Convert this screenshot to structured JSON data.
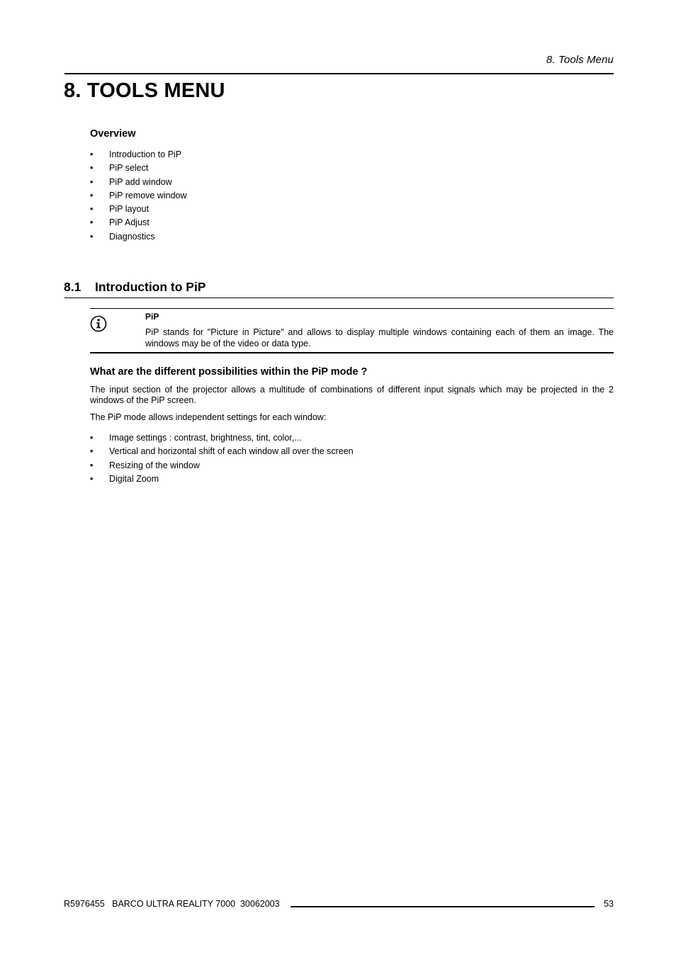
{
  "header": {
    "running_title": "8.  Tools Menu"
  },
  "chapter": {
    "title": "8. TOOLS MENU"
  },
  "overview": {
    "heading": "Overview",
    "items": [
      "Introduction to PiP",
      "PiP select",
      "PiP add window",
      "PiP remove window",
      "PiP layout",
      "PiP Adjust",
      "Diagnostics"
    ]
  },
  "section": {
    "number": "8.1",
    "title": "Introduction to PiP"
  },
  "note": {
    "icon": "info-icon",
    "title": "PiP",
    "body": "PiP stands for \"Picture in Picture\" and allows to display multiple windows containing each of them an image.  The windows may be of the video or data type."
  },
  "possibilities": {
    "heading": "What are the different possibilities within the PiP mode ?",
    "para1": "The input section of the projector allows a multitude of combinations of different input signals which may be projected in the 2 windows of the PiP screen.",
    "para2": "The PiP mode allows independent settings for each window:",
    "items": [
      "Image settings :  contrast, brightness, tint, color,...",
      "Vertical and horizontal shift of each window all over the screen",
      "Resizing of the window",
      "Digital Zoom"
    ]
  },
  "footer": {
    "doc_info": "R5976455   BARCO ULTRA REALITY 7000  30062003",
    "page_number": "53"
  },
  "bullet_glyph": "•"
}
